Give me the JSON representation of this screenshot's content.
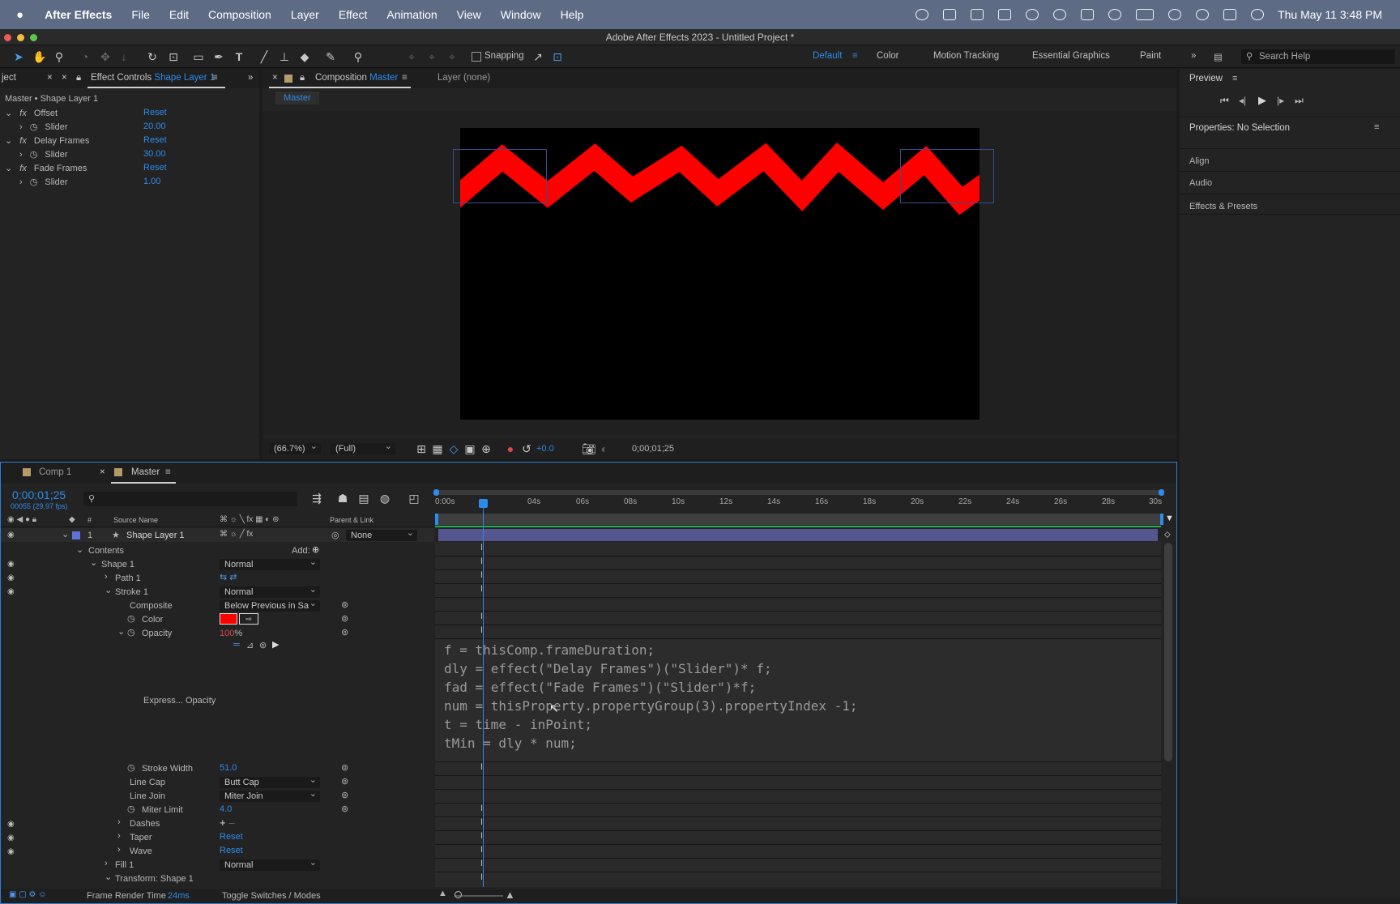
{
  "menubar": {
    "app_name": "After Effects",
    "items": [
      "File",
      "Edit",
      "Composition",
      "Layer",
      "Effect",
      "Animation",
      "View",
      "Window",
      "Help"
    ],
    "datetime": "Thu May 11  3:48 PM"
  },
  "window": {
    "title": "Adobe After Effects 2023 - Untitled Project *"
  },
  "toolbar": {
    "snapping_label": "Snapping",
    "workspaces": [
      "Default",
      "Color",
      "Motion Tracking",
      "Essential Graphics",
      "Paint"
    ],
    "search_placeholder": "Search Help"
  },
  "project_tab": {
    "label": "ject"
  },
  "effect_controls": {
    "tab_prefix": "Effect Controls",
    "tab_layer": "Shape Layer 1",
    "breadcrumb": "Master • Shape Layer 1",
    "effects": [
      {
        "name": "Offset",
        "reset": "Reset",
        "param": "Slider",
        "value": "20.00"
      },
      {
        "name": "Delay Frames",
        "reset": "Reset",
        "param": "Slider",
        "value": "30.00"
      },
      {
        "name": "Fade Frames",
        "reset": "Reset",
        "param": "Slider",
        "value": "1.00"
      }
    ]
  },
  "composition": {
    "tab_prefix": "Composition",
    "tab_name": "Master",
    "layer_tab": "Layer (none)",
    "flow_label": "Master",
    "zoom": "(66.7%)",
    "resolution": "(Full)",
    "exposure": "+0.0",
    "timecode": "0;00;01;25"
  },
  "right_panel": {
    "preview_label": "Preview",
    "properties_label": "Properties: No Selection",
    "sections": [
      "Align",
      "Audio",
      "Effects & Presets"
    ]
  },
  "timeline": {
    "tabs": [
      "Comp 1",
      "Master"
    ],
    "timecode": "0;00;01;25",
    "frame_info": "00055 (29.97 fps)",
    "col_source_name": "Source Name",
    "col_parent": "Parent & Link",
    "layer": {
      "number": "1",
      "name": "Shape Layer 1",
      "parent": "None"
    },
    "contents_label": "Contents",
    "add_label": "Add:",
    "shape_label": "Shape 1",
    "shape_mode": "Normal",
    "path_label": "Path 1",
    "stroke_label": "Stroke 1",
    "stroke_mode": "Normal",
    "composite_label": "Composite",
    "composite_value": "Below Previous in Sa",
    "color_label": "Color",
    "color_value": "#ff0000",
    "opacity_label": "Opacity",
    "opacity_value": "100",
    "opacity_unit": "%",
    "expression_label": "Express... Opacity",
    "stroke_width_label": "Stroke Width",
    "stroke_width_value": "51.0",
    "line_cap_label": "Line Cap",
    "line_cap_value": "Butt Cap",
    "line_join_label": "Line Join",
    "line_join_value": "Miter Join",
    "miter_limit_label": "Miter Limit",
    "miter_limit_value": "4.0",
    "dashes_label": "Dashes",
    "taper_label": "Taper",
    "taper_reset": "Reset",
    "wave_label": "Wave",
    "wave_reset": "Reset",
    "fill_label": "Fill 1",
    "fill_mode": "Normal",
    "transform_label": "Transform: Shape 1",
    "frame_render_label": "Frame Render Time",
    "frame_render_value": "24ms",
    "toggle_label": "Toggle Switches / Modes",
    "ruler": [
      "0:00s",
      "04s",
      "06s",
      "08s",
      "10s",
      "12s",
      "14s",
      "16s",
      "18s",
      "20s",
      "22s",
      "24s",
      "26s",
      "28s",
      "30s"
    ],
    "expression_lines": [
      "f = thisComp.frameDuration;",
      "dly = effect(\"Delay Frames\")(\"Slider\")* f;",
      "fad = effect(\"Fade Frames\")(\"Slider\")*f;",
      "num = thisProperty.propertyGroup(3).propertyIndex -1;",
      "t = time - inPoint;",
      "tMin = dly * num;"
    ]
  },
  "colors": {
    "accent": "#2d8ceb",
    "stroke": "#ff0000",
    "layer_bar": "#55558f",
    "menubar": "#5d6b85"
  }
}
